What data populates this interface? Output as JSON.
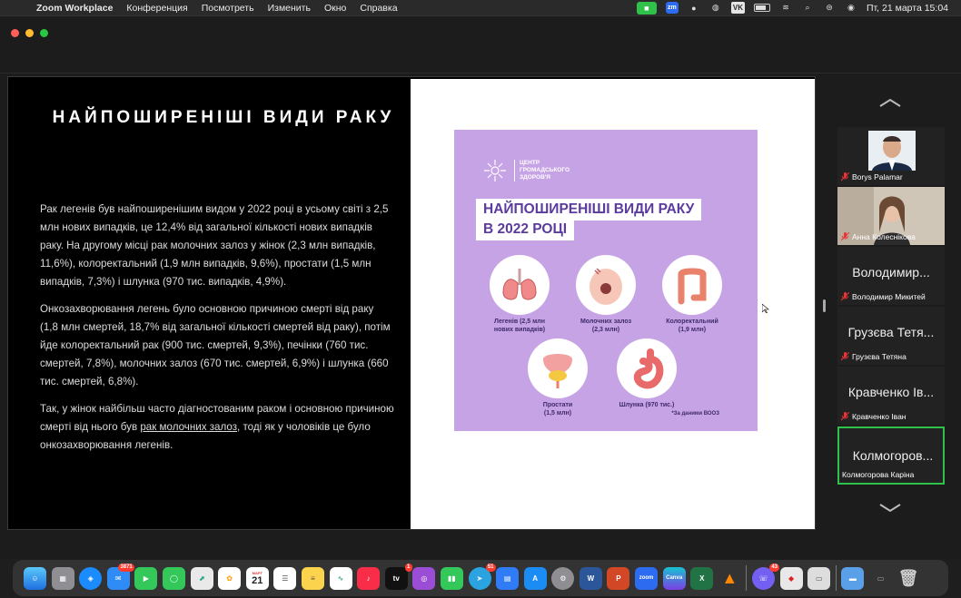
{
  "menubar": {
    "app": "Zoom Workplace",
    "items": [
      "Конференция",
      "Посмотреть",
      "Изменить",
      "Окно",
      "Справка"
    ],
    "clock": "Пт, 21 марта  15:04",
    "vk": "VK",
    "zm": "zm"
  },
  "slide": {
    "title": "НАЙПОШИРЕНІШІ ВИДИ РАКУ",
    "paragraph1": "Рак легенів був найпоширенішим видом у 2022 році в усьому світі з 2,5 млн нових випадків, це 12,4% від загальної кількості нових випадків раку. На другому місці рак молочних залоз у жінок (2,3 млн випадків, 11,6%), колоректальний (1,9 млн випадків, 9,6%), простати (1,5 млн випадків, 7,3%) і шлунка (970 тис. випадків, 4,9%).",
    "paragraph2": "Онкозахворювання легень було основною причиною смерті від раку (1,8 млн смертей, 18,7% від загальної кількості смертей від раку), потім йде колоректальний рак (900 тис. смертей, 9,3%), печінки (760 тис. смертей, 7,8%), молочних залоз (670 тис. смертей, 6,9%) і шлунка (660 тис. смертей, 6,8%).",
    "paragraph3_before": "Так, у жінок найбільш часто діагностованим раком і основною причиною смерті від нього був ",
    "paragraph3_link": "рак молочних залоз",
    "paragraph3_after": ", тоді як у чоловіків це було онкозахворювання легенів."
  },
  "poster": {
    "logo_line1": "ЦЕНТР",
    "logo_line2": "ГРОМАДСЬКОГО",
    "logo_line3": "ЗДОРОВ'Я",
    "heading1": "НАЙПОШИРЕНІШІ ВИДИ РАКУ",
    "heading2": "В 2022 РОЦІ",
    "organs": [
      {
        "label1": "Легенів (2,5 млн",
        "label2": "нових випадків)"
      },
      {
        "label1": "Молочних залоз",
        "label2": "(2,3 млн)"
      },
      {
        "label1": "Колоректальний",
        "label2": "(1,9 млн)"
      },
      {
        "label1": "Простати",
        "label2": "(1,5 млн)"
      },
      {
        "label1": "Шлунка (970 тис.)",
        "label2": ""
      }
    ],
    "note": "*За даними ВООЗ"
  },
  "participants": [
    {
      "name": "Borys Palamar",
      "display": "",
      "has_photo": true
    },
    {
      "name": "Анна Колеснікова",
      "display": "",
      "has_photo": true
    },
    {
      "name": "Володимир Микитей",
      "display": "Володимир...",
      "has_photo": false
    },
    {
      "name": "Грузєва Тетяна",
      "display": "Грузєва Тетя...",
      "has_photo": false
    },
    {
      "name": "Кравченко Іван",
      "display": "Кравченко Ів...",
      "has_photo": false
    },
    {
      "name": "Колмогорова Каріна",
      "display": "Колмогоров...",
      "has_photo": false,
      "active": true
    }
  ],
  "dock": {
    "calendar_month": "МАРТ",
    "calendar_day": "21",
    "mail_badge": "3871",
    "appletv_badge": "1",
    "telegram_badge": "51",
    "viber_badge": "43",
    "tv_label": "tv",
    "zoom_label": "zoom",
    "canva_label": "Canva"
  }
}
